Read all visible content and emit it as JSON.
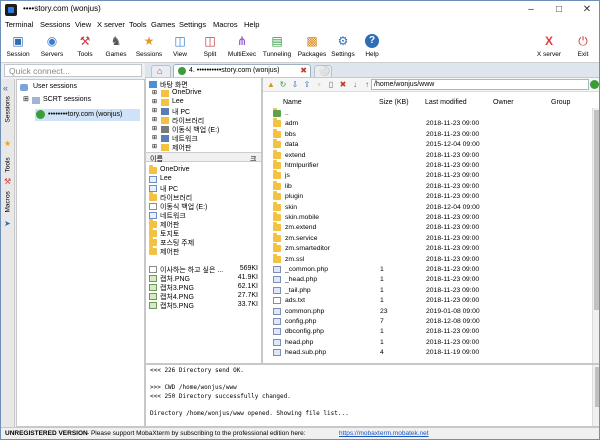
{
  "window": {
    "title": "••••story.com (wonjus)"
  },
  "menu": [
    "Terminal",
    "Sessions",
    "View",
    "X server",
    "Tools",
    "Games",
    "Settings",
    "Macros",
    "Help"
  ],
  "toolbar": [
    {
      "label": "Session",
      "icon": "session-icon",
      "color": "#2f6db5"
    },
    {
      "label": "Servers",
      "icon": "servers-icon",
      "color": "#3b7ad0"
    },
    {
      "label": "Tools",
      "icon": "tools-icon",
      "color": "#d03b3b"
    },
    {
      "label": "Games",
      "icon": "games-icon",
      "color": "#555555"
    },
    {
      "label": "Sessions",
      "icon": "sessions-icon",
      "color": "#e09a2a"
    },
    {
      "label": "View",
      "icon": "view-icon",
      "color": "#3b7ad0"
    },
    {
      "label": "Split",
      "icon": "split-icon",
      "color": "#c23b3b"
    },
    {
      "label": "MultiExec",
      "icon": "multiexec-icon",
      "color": "#7a3bc2"
    },
    {
      "label": "Tunneling",
      "icon": "tunneling-icon",
      "color": "#2e9a3e"
    },
    {
      "label": "Packages",
      "icon": "packages-icon",
      "color": "#d88a1c"
    },
    {
      "label": "Settings",
      "icon": "settings-icon",
      "color": "#2f6db5"
    },
    {
      "label": "Help",
      "icon": "help-icon",
      "color": "#2f6db5"
    },
    {
      "label": "X server",
      "icon": "xserver-icon",
      "color": "#e03b3b"
    },
    {
      "label": "Exit",
      "icon": "exit-icon",
      "color": "#c0392b"
    }
  ],
  "quick_connect": {
    "placeholder": "Quick connect..."
  },
  "side_tabs": [
    "Sessions",
    "Tools",
    "Macros"
  ],
  "sessions_tree": {
    "root": "User sessions",
    "group": "SCRT sessions",
    "active": "••••••••tory.com (wonjus)"
  },
  "tabs": {
    "active": "4. ••••••••••story.com (wonjus)"
  },
  "local_tree": [
    "바탕 화면",
    "OneDrive",
    "Lee",
    "내 PC",
    "라이브러리",
    "이동식 백업 (E:)",
    "네트워크",
    "제어판"
  ],
  "local_list_header": {
    "name": "이름",
    "size": "크"
  },
  "local_list": [
    {
      "name": "OneDrive",
      "size": "",
      "type": "folder"
    },
    {
      "name": "Lee",
      "size": "",
      "type": "user"
    },
    {
      "name": "내 PC",
      "size": "",
      "type": "pc"
    },
    {
      "name": "라이브러리",
      "size": "",
      "type": "folder"
    },
    {
      "name": "이동식 백업 (E:)",
      "size": "",
      "type": "drive"
    },
    {
      "name": "네트워크",
      "size": "",
      "type": "net"
    },
    {
      "name": "제어판",
      "size": "",
      "type": "folder"
    },
    {
      "name": "토지토",
      "size": "",
      "type": "folder"
    },
    {
      "name": "포스팅 주제",
      "size": "",
      "type": "folder"
    },
    {
      "name": "제어판",
      "size": "",
      "type": "folder"
    },
    {
      "name": "",
      "size": "",
      "type": "blank"
    },
    {
      "name": "이사하는 하고 싶은 ...",
      "size": "569KI",
      "type": "txt"
    },
    {
      "name": "캡처.PNG",
      "size": "41.9KI",
      "type": "png"
    },
    {
      "name": "캡처3.PNG",
      "size": "62.1KI",
      "type": "png"
    },
    {
      "name": "캡처4.PNG",
      "size": "27.7KI",
      "type": "png"
    },
    {
      "name": "캡처5.PNG",
      "size": "33.7KI",
      "type": "png"
    }
  ],
  "remote": {
    "path": "/home/wonjus/www",
    "headers": {
      "name": "Name",
      "size": "Size (KB)",
      "modified": "Last modified",
      "owner": "Owner",
      "group": "Group"
    },
    "files": [
      {
        "name": "..",
        "size": "",
        "modified": "",
        "type": "up"
      },
      {
        "name": "adm",
        "size": "",
        "modified": "2018-11-23 09:00",
        "type": "folder"
      },
      {
        "name": "bbs",
        "size": "",
        "modified": "2018-11-23 09:00",
        "type": "folder"
      },
      {
        "name": "data",
        "size": "",
        "modified": "2015-12-04 09:00",
        "type": "folder"
      },
      {
        "name": "extend",
        "size": "",
        "modified": "2018-11-23 09:00",
        "type": "folder"
      },
      {
        "name": "htmlpurifier",
        "size": "",
        "modified": "2018-11-23 09:00",
        "type": "folder"
      },
      {
        "name": "js",
        "size": "",
        "modified": "2018-11-23 09:00",
        "type": "folder"
      },
      {
        "name": "lib",
        "size": "",
        "modified": "2018-11-23 09:00",
        "type": "folder"
      },
      {
        "name": "plugin",
        "size": "",
        "modified": "2018-11-23 09:00",
        "type": "folder"
      },
      {
        "name": "skin",
        "size": "",
        "modified": "2018-12-04 09:00",
        "type": "folder"
      },
      {
        "name": "skin.mobile",
        "size": "",
        "modified": "2018-11-23 09:00",
        "type": "folder"
      },
      {
        "name": "zm.extend",
        "size": "",
        "modified": "2018-11-23 09:00",
        "type": "folder"
      },
      {
        "name": "zm.service",
        "size": "",
        "modified": "2018-11-23 09:00",
        "type": "folder"
      },
      {
        "name": "zm.smarteditor",
        "size": "",
        "modified": "2018-11-23 09:00",
        "type": "folder"
      },
      {
        "name": "zm.ssl",
        "size": "",
        "modified": "2018-11-23 09:00",
        "type": "folder"
      },
      {
        "name": "_common.php",
        "size": "1",
        "modified": "2018-11-23 09:00",
        "type": "php"
      },
      {
        "name": "_head.php",
        "size": "1",
        "modified": "2018-11-23 09:00",
        "type": "php"
      },
      {
        "name": "_tail.php",
        "size": "1",
        "modified": "2018-11-23 09:00",
        "type": "php"
      },
      {
        "name": "ads.txt",
        "size": "1",
        "modified": "2018-11-23 09:00",
        "type": "txt"
      },
      {
        "name": "common.php",
        "size": "23",
        "modified": "2019-01-08 09:00",
        "type": "php"
      },
      {
        "name": "config.php",
        "size": "7",
        "modified": "2018-12-08 09:00",
        "type": "php"
      },
      {
        "name": "dbconfig.php",
        "size": "1",
        "modified": "2018-11-23 09:00",
        "type": "php"
      },
      {
        "name": "head.php",
        "size": "1",
        "modified": "2018-11-23 09:00",
        "type": "php"
      },
      {
        "name": "head.sub.php",
        "size": "4",
        "modified": "2018-11-19 09:00",
        "type": "php"
      }
    ]
  },
  "terminal_lines": [
    "<<<  226 Directory send OK.",
    "",
    ">>>  CWD /home/wonjus/www",
    "<<<  250 Directory successfully changed.",
    "",
    "Directory /home/wonjus/www opened. Showing file list..."
  ],
  "status": {
    "prefix": "UNREGISTERED VERSION",
    "text": " -  Please support MobaXterm by subscribing to the professional edition here: ",
    "link": "https://mobaxterm.mobatek.net"
  }
}
